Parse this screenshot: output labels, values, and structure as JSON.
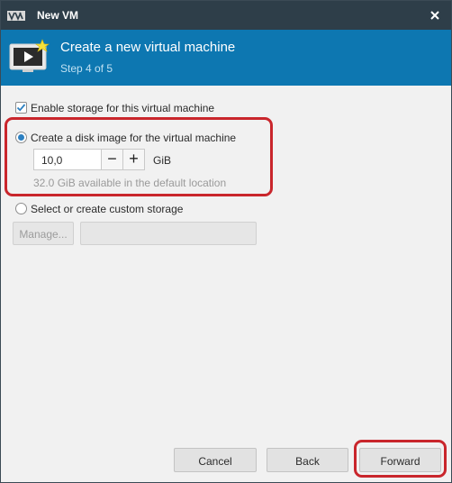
{
  "window": {
    "title": "New VM",
    "close_icon": "close-icon",
    "logo_icon": "virt-manager-logo"
  },
  "header": {
    "title": "Create a new virtual machine",
    "step": "Step 4 of 5",
    "icon": "new-vm-icon"
  },
  "storage": {
    "enable_label": "Enable storage for this virtual machine",
    "enable_checked": true,
    "create_disk_label": "Create a disk image for the virtual machine",
    "create_disk_selected": true,
    "size_value": "10,0",
    "minus_icon": "minus-icon",
    "plus_icon": "plus-icon",
    "unit": "GiB",
    "available_text": "32.0 GiB available in the default location",
    "custom_label": "Select or create custom storage",
    "custom_selected": false,
    "manage_label": "Manage...",
    "custom_path_value": ""
  },
  "buttons": {
    "cancel": "Cancel",
    "back": "Back",
    "forward": "Forward"
  },
  "colors": {
    "titlebar": "#2e3e49",
    "header": "#0d77b1",
    "accent": "#2b7fc1",
    "highlight": "#c9262c"
  }
}
